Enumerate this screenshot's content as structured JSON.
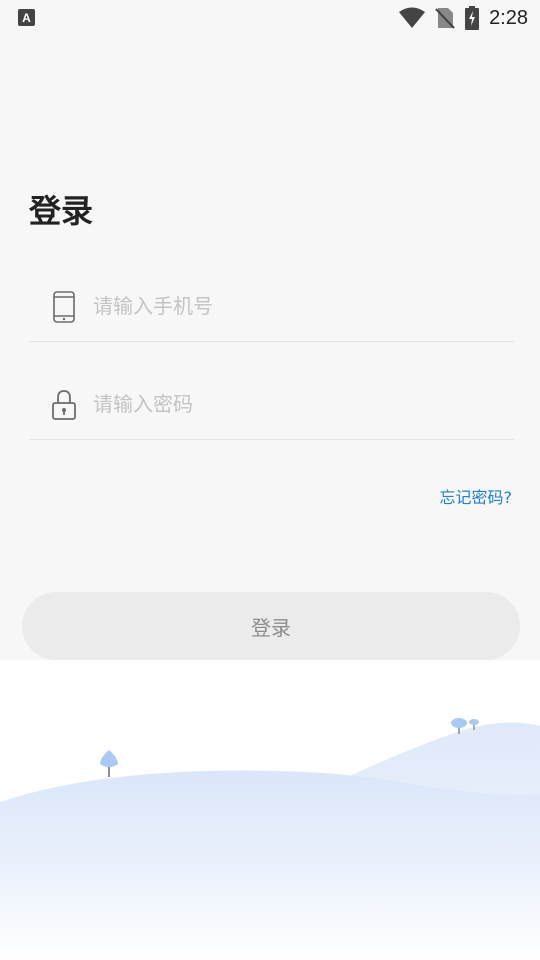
{
  "status_bar": {
    "time": "2:28",
    "notification_icon": "a-notification-icon",
    "wifi_icon": "wifi-icon",
    "no_sim_icon": "no-sim-icon",
    "battery_icon": "battery-charging-icon"
  },
  "page": {
    "title": "登录"
  },
  "phone_field": {
    "icon": "phone-icon",
    "placeholder": "请输入手机号",
    "value": ""
  },
  "password_field": {
    "icon": "lock-icon",
    "placeholder": "请输入密码",
    "value": ""
  },
  "forgot_password": {
    "label": "忘记密码?"
  },
  "login_button": {
    "label": "登录"
  },
  "colors": {
    "background": "#f7f7f7",
    "link": "#1e7ed0",
    "button_bg": "#ebebeb",
    "button_text": "#8c8c8c",
    "hill": "#dce8fa"
  }
}
